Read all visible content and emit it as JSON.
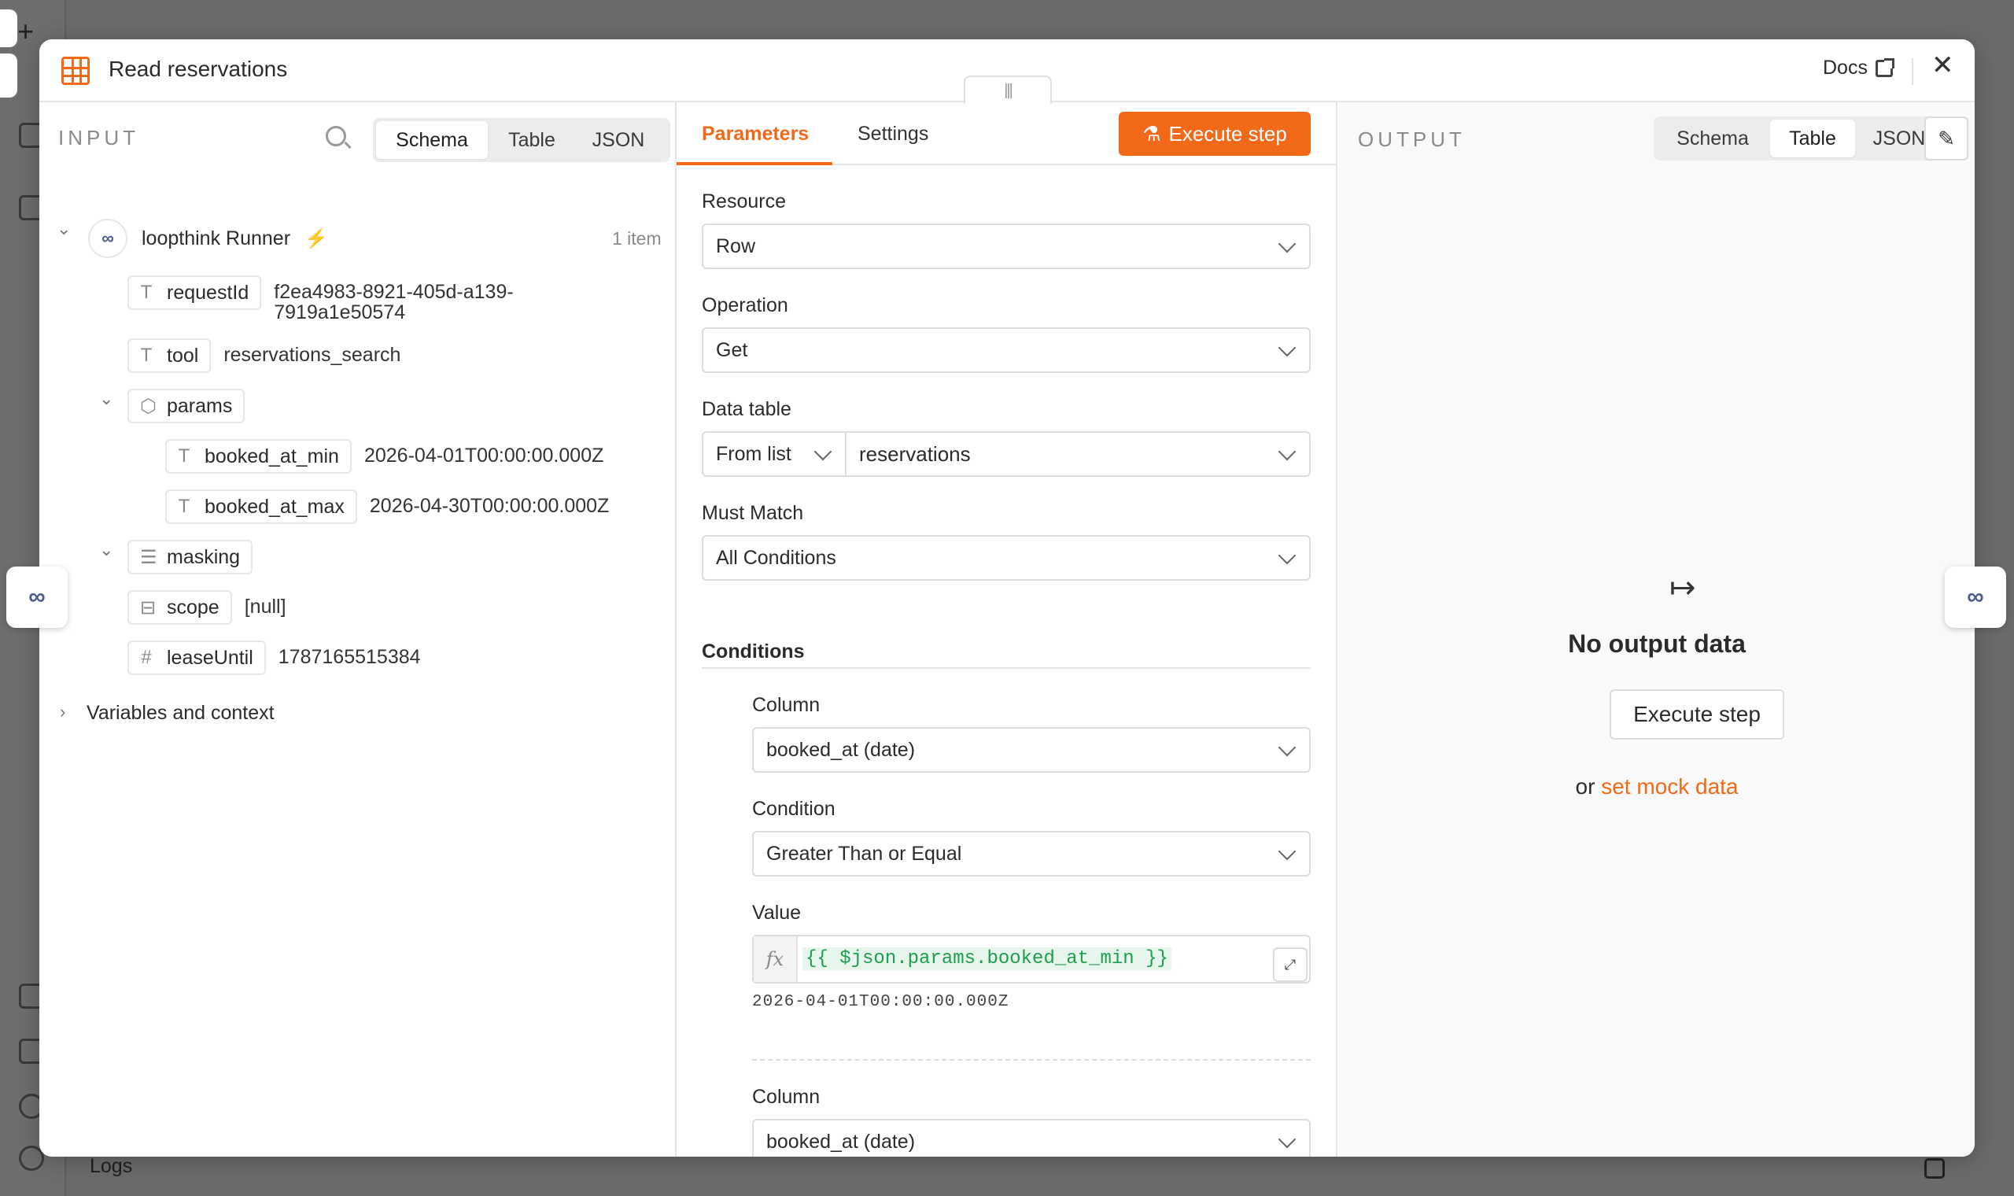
{
  "modal": {
    "title": "Read reservations",
    "docs_label": "Docs",
    "close_glyph": "✕",
    "drag_glyph": "|||"
  },
  "input": {
    "section_title": "INPUT",
    "view_tabs": [
      "Schema",
      "Table",
      "JSON"
    ],
    "active_view": "Schema",
    "node": {
      "name": "loopthink Runner",
      "icon": "infinity-icon",
      "item_count": "1 item",
      "trigger_glyph": "⚡"
    },
    "fields": {
      "requestId": {
        "type_glyph": "T",
        "key": "requestId",
        "value_line1": "f2ea4983-8921-405d-a139-",
        "value_line2": "7919a1e50574"
      },
      "tool": {
        "type_glyph": "T",
        "key": "tool",
        "value": "reservations_search"
      },
      "params": {
        "type_glyph": "⬡",
        "key": "params"
      },
      "booked_at_min": {
        "type_glyph": "T",
        "key": "booked_at_min",
        "value": "2026-04-01T00:00:00.000Z"
      },
      "booked_at_max": {
        "type_glyph": "T",
        "key": "booked_at_max",
        "value": "2026-04-30T00:00:00.000Z"
      },
      "masking": {
        "type_glyph": "☰",
        "key": "masking"
      },
      "scope": {
        "type_glyph": "⊟",
        "key": "scope",
        "value": "[null]"
      },
      "leaseUntil": {
        "type_glyph": "#",
        "key": "leaseUntil",
        "value": "1787165515384"
      }
    },
    "variables_label": "Variables and context"
  },
  "params": {
    "tabs": [
      "Parameters",
      "Settings"
    ],
    "active_tab": "Parameters",
    "execute_label": "Execute step",
    "resource": {
      "label": "Resource",
      "value": "Row"
    },
    "operation": {
      "label": "Operation",
      "value": "Get"
    },
    "data_table": {
      "label": "Data table",
      "mode": "From list",
      "value": "reservations"
    },
    "must_match": {
      "label": "Must Match",
      "value": "All Conditions"
    },
    "conditions_label": "Conditions",
    "condition1": {
      "column_label": "Column",
      "column_value": "booked_at (date)",
      "condition_label": "Condition",
      "condition_value": "Greater Than or Equal",
      "value_label": "Value",
      "fx_glyph": "fx",
      "expression": "{{ $json.params.booked_at_min }}",
      "resolved": "2026-04-01T00:00:00.000Z"
    },
    "condition2": {
      "column_label": "Column",
      "column_value": "booked_at (date)"
    }
  },
  "output": {
    "section_title": "OUTPUT",
    "view_tabs": [
      "Schema",
      "Table",
      "JSON"
    ],
    "active_view": "Table",
    "empty_glyph": "↦",
    "empty_title": "No output data",
    "execute_label": "Execute step",
    "mock_prefix": "or",
    "mock_link": "set mock data"
  },
  "background": {
    "logs_label": "Logs",
    "plus_glyph": "+"
  },
  "colors": {
    "accent": "#f2691a",
    "expression": "#1e9e4f"
  }
}
